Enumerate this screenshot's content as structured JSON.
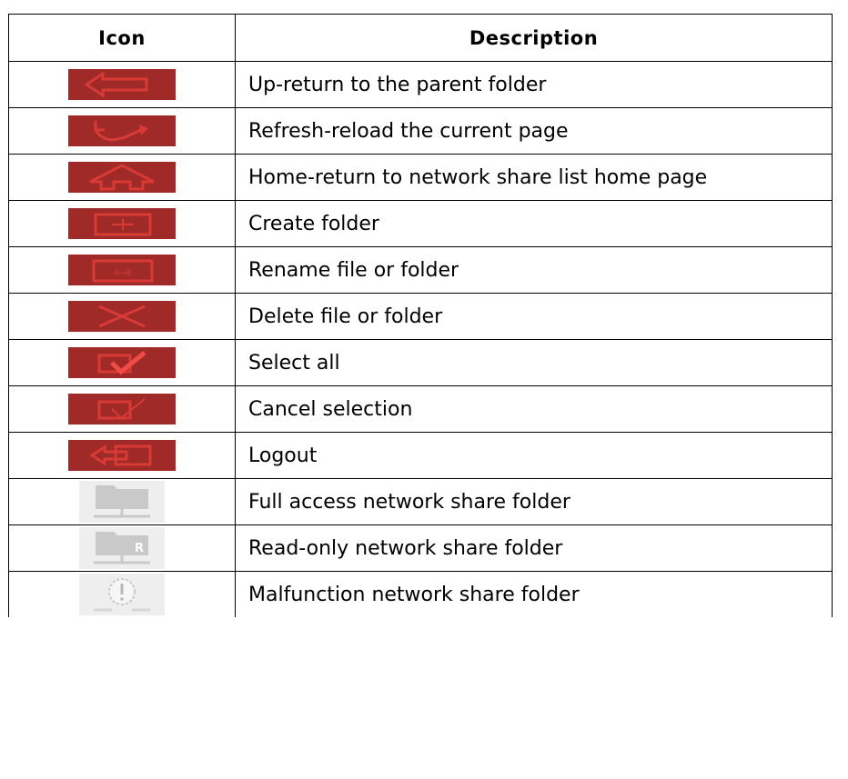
{
  "table": {
    "headers": {
      "icon": "Icon",
      "description": "Description"
    },
    "rows": [
      {
        "icon": "up-arrow-icon",
        "description": "Up-return to the parent folder"
      },
      {
        "icon": "refresh-icon",
        "description": "Refresh-reload the current page"
      },
      {
        "icon": "home-icon",
        "description": "Home-return to network share list home page"
      },
      {
        "icon": "create-folder-icon",
        "description": "Create folder"
      },
      {
        "icon": "rename-icon",
        "description": "Rename file or folder"
      },
      {
        "icon": "delete-icon",
        "description": "Delete file or folder"
      },
      {
        "icon": "select-all-icon",
        "description": "Select all"
      },
      {
        "icon": "cancel-selection-icon",
        "description": "Cancel selection"
      },
      {
        "icon": "logout-icon",
        "description": "Logout"
      },
      {
        "icon": "full-access-share-folder-icon",
        "description": "Full access network share folder"
      },
      {
        "icon": "read-only-share-folder-icon",
        "description": "Read-only network share folder"
      },
      {
        "icon": "malfunction-share-folder-icon",
        "description": "Malfunction network share folder"
      }
    ]
  },
  "colors": {
    "button_bg": "#a02a28",
    "button_glyph": "#d83a36",
    "share_bg": "#eeeeee",
    "share_glyph": "#c9c9c9"
  },
  "share_badge_letter": "R",
  "rename_badge_text": "A→B"
}
